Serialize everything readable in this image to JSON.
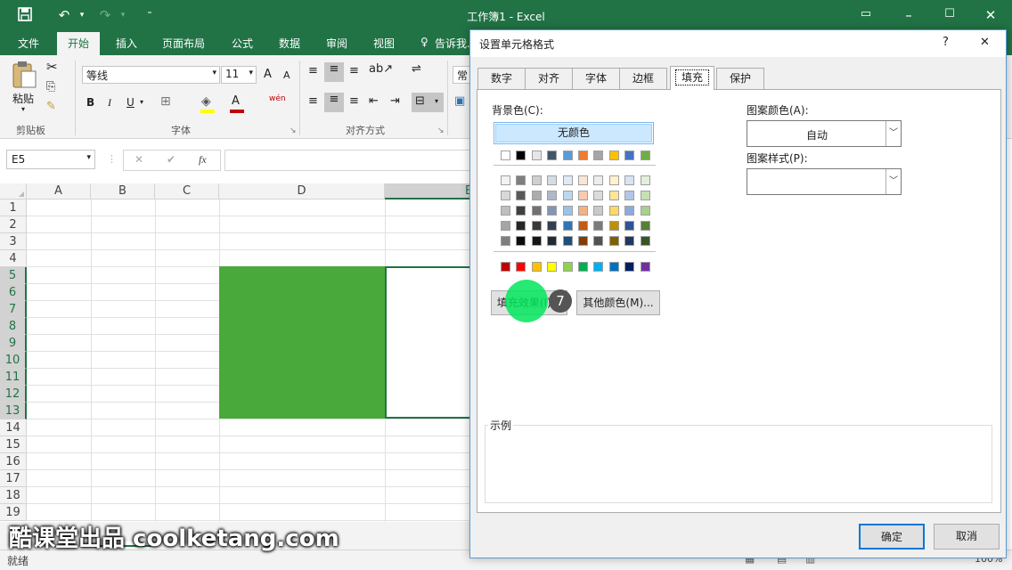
{
  "titlebar": {
    "title": "工作簿1 - Excel",
    "save_icon": "save-icon",
    "undo_icon": "undo-icon",
    "redo_icon": "redo-icon"
  },
  "ribbon_tabs": [
    "文件",
    "开始",
    "插入",
    "页面布局",
    "公式",
    "数据",
    "审阅",
    "视图",
    "告诉我..."
  ],
  "ribbon": {
    "clipboard": {
      "paste_label": "粘贴",
      "group_label": "剪贴板"
    },
    "font": {
      "font_name": "等线",
      "font_size": "11",
      "bold": "B",
      "italic": "I",
      "underline": "U",
      "grow": "A",
      "shrink": "A",
      "font_color_letter": "A",
      "phonetic": "wén",
      "group_label": "字体"
    },
    "alignment": {
      "group_label": "对齐方式"
    },
    "number": {
      "format": "常规"
    }
  },
  "formula_bar": {
    "name_box": "E5",
    "fx": "fx",
    "cancel": "✕",
    "enter": "✔"
  },
  "grid": {
    "columns": [
      "A",
      "B",
      "C",
      "D",
      "E"
    ],
    "rows": [
      "1",
      "2",
      "3",
      "4",
      "5",
      "6",
      "7",
      "8",
      "9",
      "10",
      "11",
      "12",
      "13",
      "14",
      "15",
      "16",
      "17",
      "18",
      "19"
    ],
    "fill_color": "#4aa93b"
  },
  "statusbar": {
    "status": "就绪",
    "zoom": "100%"
  },
  "watermark": "酷课堂出品 coolketang.com",
  "dialog": {
    "title": "设置单元格格式",
    "help": "?",
    "close": "✕",
    "tabs": [
      "数字",
      "对齐",
      "字体",
      "边框",
      "填充",
      "保护"
    ],
    "active_tab": "填充",
    "background_label": "背景色(C):",
    "no_color": "无颜色",
    "theme_row": [
      "#ffffff",
      "#000000",
      "#e7e6e6",
      "#44546a",
      "#5b9bd5",
      "#ed7d31",
      "#a5a5a5",
      "#ffc000",
      "#4472c4",
      "#70ad47"
    ],
    "shade_rows": [
      [
        "#f2f2f2",
        "#7f7f7f",
        "#d0cece",
        "#d6dce4",
        "#deebf6",
        "#fbe5d5",
        "#ededed",
        "#fff2cc",
        "#dae3f3",
        "#e2efd9"
      ],
      [
        "#d8d8d8",
        "#595959",
        "#aeabab",
        "#adb9ca",
        "#bdd7ee",
        "#f7cbac",
        "#dbdbdb",
        "#fee599",
        "#b4c6e7",
        "#c5e0b3"
      ],
      [
        "#bfbfbf",
        "#3f3f3f",
        "#757070",
        "#8496b0",
        "#9dc3e6",
        "#f4b183",
        "#c9c9c9",
        "#ffd965",
        "#8eaadb",
        "#a8d08d"
      ],
      [
        "#a5a5a5",
        "#262626",
        "#3a3838",
        "#333f4f",
        "#2e75b5",
        "#c55a11",
        "#7b7b7b",
        "#bf9000",
        "#2f5496",
        "#538135"
      ],
      [
        "#7f7f7f",
        "#0c0c0c",
        "#171616",
        "#222a35",
        "#1e4e79",
        "#843c0b",
        "#525252",
        "#7f6000",
        "#1f3864",
        "#375623"
      ]
    ],
    "standard_row": [
      "#c00000",
      "#ff0000",
      "#ffc000",
      "#ffff00",
      "#92d050",
      "#00b050",
      "#00b0f0",
      "#0070c0",
      "#002060",
      "#7030a0"
    ],
    "fill_effects_button": "填充效果(I)...",
    "more_colors_button": "其他颜色(M)...",
    "pattern_color_label": "图案颜色(A):",
    "pattern_color_value": "自动",
    "pattern_style_label": "图案样式(P):",
    "sample_label": "示例",
    "ok": "确定",
    "cancel": "取消",
    "step_number": "7"
  }
}
